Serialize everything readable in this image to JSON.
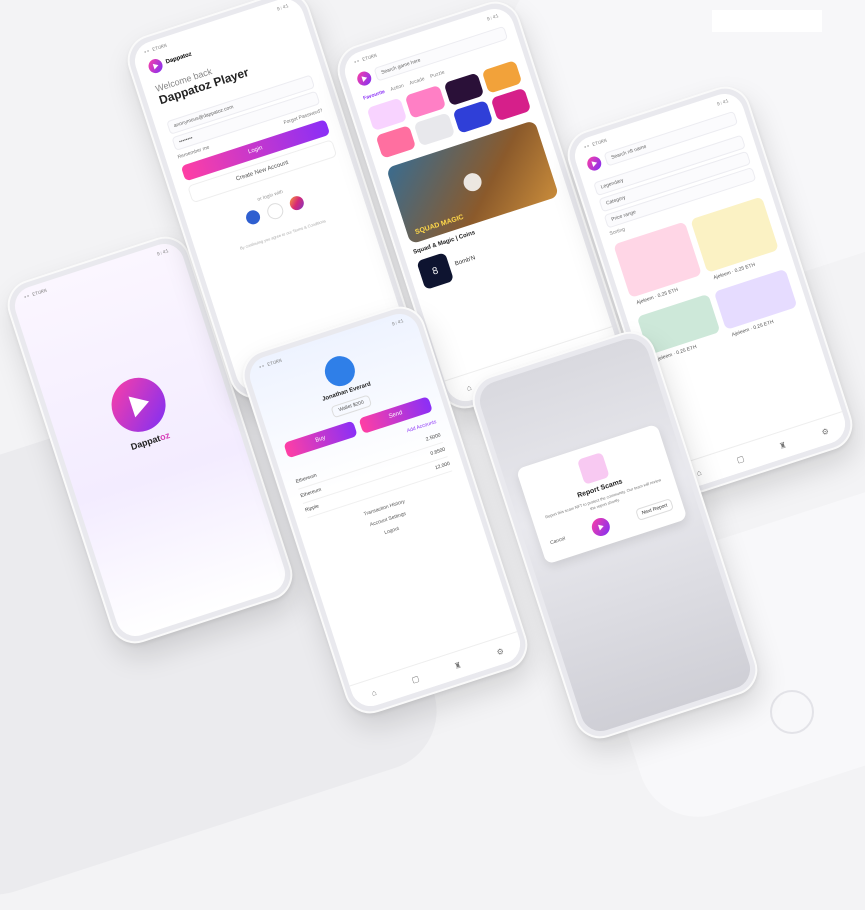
{
  "status_bar": {
    "carrier": "•• ETURN",
    "time": "9:41"
  },
  "brand": {
    "name": "Dappatoz",
    "colors": {
      "pink": "#ff3fa4",
      "purple": "#7b2ff7"
    }
  },
  "splash": {
    "brand_prefix": "Dappat",
    "brand_suffix": "oz"
  },
  "login": {
    "greeting": "Welcome back",
    "title": "Dappatoz Player",
    "email_value": "anonymous@dappatoz.com",
    "password_value": "••••••••",
    "remember_label": "Remember me",
    "forgot_label": "Forgot Password?",
    "login_button": "Login",
    "create_button": "Create New Account",
    "social_label": "or login with",
    "social_icons": [
      "facebook-icon",
      "google-icon",
      "instagram-icon"
    ],
    "footer": "By continuing you agree to our Terms & Conditions"
  },
  "games": {
    "search_placeholder": "Search game here",
    "tabs": [
      "Favourite",
      "Action",
      "Arcade",
      "Puzzle"
    ],
    "banner_title": "Squad & Magic | Coins",
    "banner_art_text": "SQUAD MAGIC",
    "item_title": "Bomb'N",
    "item_badge": "8"
  },
  "nft": {
    "search_placeholder": "Search nft name",
    "filters": [
      "Legendary",
      "Category",
      "Price range"
    ],
    "sort_label": "Sorting",
    "cards": [
      {
        "owner": "Ajeleem",
        "price": "0.25 ETH"
      },
      {
        "owner": "Ajeleem",
        "price": "0.25 ETH"
      },
      {
        "owner": "Ajeleem",
        "price": "0.25 ETH"
      },
      {
        "owner": "Ajeleem",
        "price": "0.25 ETH"
      }
    ]
  },
  "profile": {
    "username": "Jonathan Everard",
    "wallet": "Wallet $200",
    "buttons": [
      "Buy",
      "Send"
    ],
    "section_label": "Add Accounts",
    "crypto": [
      {
        "name": "Ethereum",
        "value": "2.5000"
      },
      {
        "name": "Ethereum",
        "value": "0.8500"
      },
      {
        "name": "Ripple",
        "value": "12.000"
      }
    ],
    "menu": [
      "Transaction History",
      "Account Settings",
      "Logout"
    ]
  },
  "modal": {
    "title": "Report Scams",
    "body": "Report this scam NFT to protect the community. Our team will review the report shortly.",
    "cancel": "Cancel",
    "confirm": "Next Report"
  }
}
